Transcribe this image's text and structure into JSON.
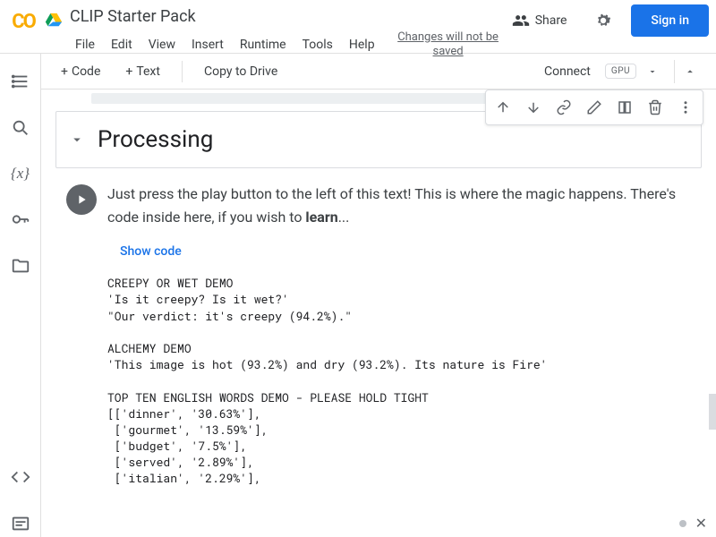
{
  "header": {
    "title": "CLIP Starter Pack",
    "menu": [
      "File",
      "Edit",
      "View",
      "Insert",
      "Runtime",
      "Tools",
      "Help"
    ],
    "changes_note": "Changes will not be saved",
    "share": "Share",
    "signin": "Sign in"
  },
  "toolbar": {
    "code": "Code",
    "text": "Text",
    "copy": "Copy to Drive",
    "connect": "Connect",
    "gpu": "GPU"
  },
  "section": {
    "title": "Processing"
  },
  "cell": {
    "desc_prefix": "Just press the play button to the left of this text! This is where the magic happens. There's code inside here, if you wish to ",
    "desc_bold": "learn",
    "desc_suffix": "...",
    "show_code": "Show code",
    "output": "CREEPY OR WET DEMO\n'Is it creepy? Is it wet?'\n\"Our verdict: it's creepy (94.2%).\"\n\nALCHEMY DEMO\n'This image is hot (93.2%) and dry (93.2%). Its nature is Fire'\n\nTOP TEN ENGLISH WORDS DEMO - PLEASE HOLD TIGHT\n[['dinner', '30.63%'],\n ['gourmet', '13.59%'],\n ['budget', '7.5%'],\n ['served', '2.89%'],\n ['italian', '2.29%'],"
  }
}
